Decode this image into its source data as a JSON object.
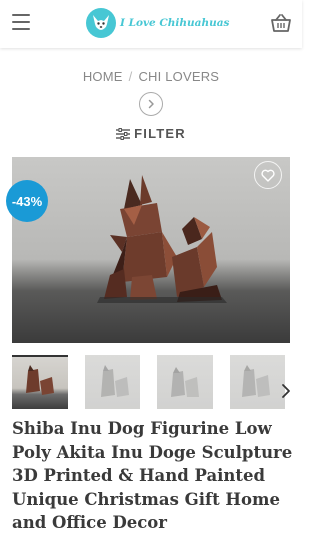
{
  "header": {
    "logo_text": "I Love Chihuahuas",
    "menu_icon": "hamburger-menu-icon",
    "cart_icon": "basket-icon",
    "accent_color": "#47c7d4"
  },
  "breadcrumb": {
    "home": "HOME",
    "separator": "/",
    "category": "CHI LOVERS"
  },
  "filter": {
    "label": "FILTER",
    "icon": "filter-sliders-icon"
  },
  "product": {
    "sale_badge": "-43%",
    "sale_color": "#1a9ad6",
    "wishlist_icon": "heart-icon",
    "title": "Shiba Inu Dog Figurine Low Poly Akita Inu Doge Sculpture 3D Printed & Hand Painted Unique Christmas Gift Home and Office Decor"
  }
}
